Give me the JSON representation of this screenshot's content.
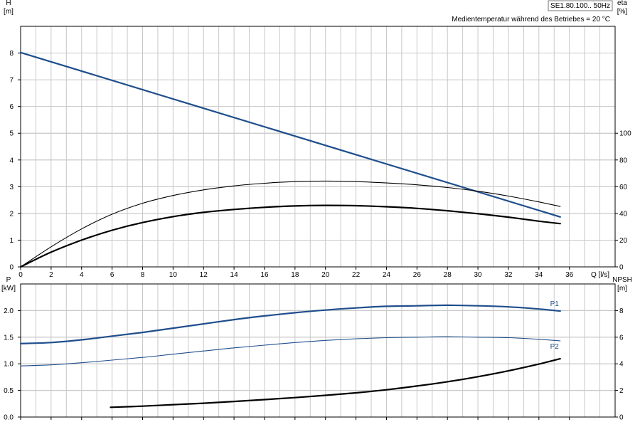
{
  "header": {
    "title": "SE1.80.100.. 50Hz",
    "subtitle": "Medientemperatur während des Betriebes = 20 °C"
  },
  "chart_data": [
    {
      "type": "line",
      "x_label": "Q [l/s]",
      "y_label_left": [
        "H",
        "[m]"
      ],
      "y_label_right": [
        "eta",
        "[%]"
      ],
      "x_ticks": [
        0,
        2,
        4,
        6,
        8,
        10,
        12,
        14,
        16,
        18,
        20,
        22,
        24,
        26,
        28,
        30,
        32,
        34,
        36
      ],
      "y_left_ticks": [
        0,
        1,
        2,
        3,
        4,
        5,
        6,
        7,
        8
      ],
      "y_right_ticks": [
        0,
        20,
        40,
        60,
        80,
        100
      ],
      "xlim": [
        0,
        39
      ],
      "ylim_left": [
        0,
        9
      ],
      "ylim_right": [
        0,
        180
      ],
      "grid": true,
      "series": [
        {
          "axis": "left",
          "color": "#1f4e8c",
          "x": [
            0,
            35.4
          ],
          "y": [
            8.02,
            1.87
          ]
        },
        {
          "axis": "left",
          "color": "#000000",
          "weight": "thin",
          "x": [
            0,
            2,
            4,
            6,
            8,
            10,
            12,
            14,
            16,
            18,
            20,
            22,
            24,
            26,
            28,
            30,
            32,
            34,
            35.4
          ],
          "y": [
            0,
            0.75,
            1.42,
            1.97,
            2.38,
            2.67,
            2.88,
            3.03,
            3.13,
            3.19,
            3.21,
            3.19,
            3.14,
            3.07,
            2.97,
            2.83,
            2.65,
            2.43,
            2.26
          ]
        },
        {
          "axis": "left",
          "color": "#000000",
          "weight": "thick",
          "x": [
            0,
            2,
            4,
            6,
            8,
            10,
            12,
            14,
            16,
            18,
            20,
            22,
            24,
            26,
            28,
            30,
            32,
            34,
            35.4
          ],
          "y": [
            0,
            0.55,
            1.0,
            1.37,
            1.66,
            1.88,
            2.04,
            2.15,
            2.23,
            2.28,
            2.3,
            2.29,
            2.25,
            2.19,
            2.1,
            1.99,
            1.86,
            1.71,
            1.62
          ]
        }
      ]
    },
    {
      "type": "line",
      "x_label": "",
      "y_label_left": [
        "P",
        "[kW]"
      ],
      "y_label_right": [
        "NPSH",
        "[m]"
      ],
      "x_ticks": [
        0,
        2,
        4,
        6,
        8,
        10,
        12,
        14,
        16,
        18,
        20,
        22,
        24,
        26,
        28,
        30,
        32,
        34,
        36
      ],
      "y_left_ticks": [
        "0.0",
        "0.5",
        "1.0",
        "1.5",
        "2.0"
      ],
      "y_right_ticks": [
        0,
        2,
        4,
        6,
        8
      ],
      "xlim": [
        0,
        39
      ],
      "ylim_left": [
        0,
        2.5
      ],
      "ylim_right": [
        0,
        10
      ],
      "grid": true,
      "series": [
        {
          "name": "P1",
          "axis": "left",
          "color": "#1f4e8c",
          "weight": "thick",
          "x": [
            0,
            2,
            4,
            6,
            8,
            10,
            12,
            14,
            16,
            18,
            20,
            22,
            24,
            26,
            28,
            30,
            32,
            34,
            35.4
          ],
          "y": [
            1.38,
            1.4,
            1.45,
            1.52,
            1.59,
            1.67,
            1.75,
            1.83,
            1.9,
            1.96,
            2.01,
            2.05,
            2.08,
            2.09,
            2.1,
            2.09,
            2.07,
            2.03,
            1.99
          ]
        },
        {
          "name": "P2",
          "axis": "left",
          "color": "#1f4e8c",
          "weight": "thin",
          "x": [
            0,
            2,
            4,
            6,
            8,
            10,
            12,
            14,
            16,
            18,
            20,
            22,
            24,
            26,
            28,
            30,
            32,
            34,
            35.4
          ],
          "y": [
            0.96,
            0.98,
            1.02,
            1.07,
            1.12,
            1.18,
            1.24,
            1.3,
            1.35,
            1.4,
            1.44,
            1.47,
            1.49,
            1.5,
            1.51,
            1.5,
            1.49,
            1.46,
            1.43
          ]
        },
        {
          "axis": "right",
          "color": "#000000",
          "weight": "thick",
          "x": [
            5.9,
            8,
            10,
            12,
            14,
            16,
            18,
            20,
            22,
            24,
            26,
            28,
            30,
            32,
            34,
            35.4
          ],
          "y": [
            0.73,
            0.82,
            0.93,
            1.04,
            1.17,
            1.31,
            1.46,
            1.63,
            1.82,
            2.05,
            2.33,
            2.65,
            3.03,
            3.47,
            3.98,
            4.38
          ]
        }
      ]
    }
  ]
}
